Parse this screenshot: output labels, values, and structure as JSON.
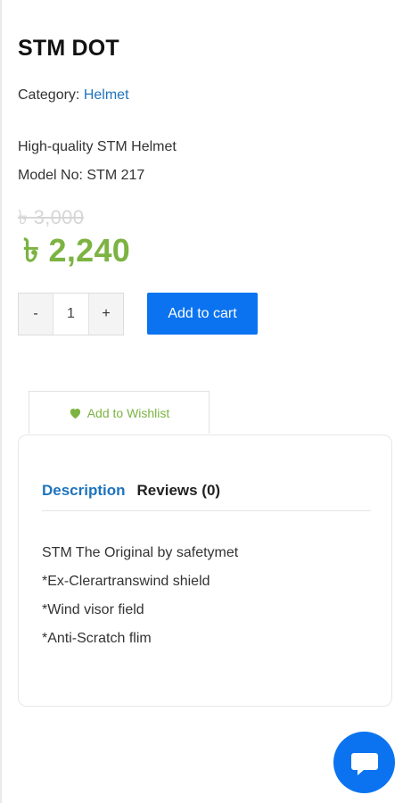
{
  "product": {
    "title": "STM DOT",
    "category_label": "Category:",
    "category_link": "Helmet",
    "desc_line1": "High-quality STM Helmet",
    "desc_line2": "Model No: STM 217",
    "old_price": "৳ 3,000",
    "new_price": "৳ 2,240"
  },
  "cart": {
    "minus": "-",
    "quantity": "1",
    "plus": "+",
    "add_to_cart": "Add to cart"
  },
  "wishlist": {
    "label": "Add to Wishlist",
    "icon": "heart-icon"
  },
  "tabs": {
    "description": "Description",
    "reviews": "Reviews (0)"
  },
  "description": [
    "STM The Original by safetymet",
    "*Ex-Clerartranswind shield",
    "*Wind visor field",
    "*Anti-Scratch flim"
  ],
  "chat": {
    "icon": "chat-bubble-icon"
  },
  "colors": {
    "accent_blue": "#0b73f0",
    "link_blue": "#1e73be",
    "price_green": "#7cb342"
  }
}
